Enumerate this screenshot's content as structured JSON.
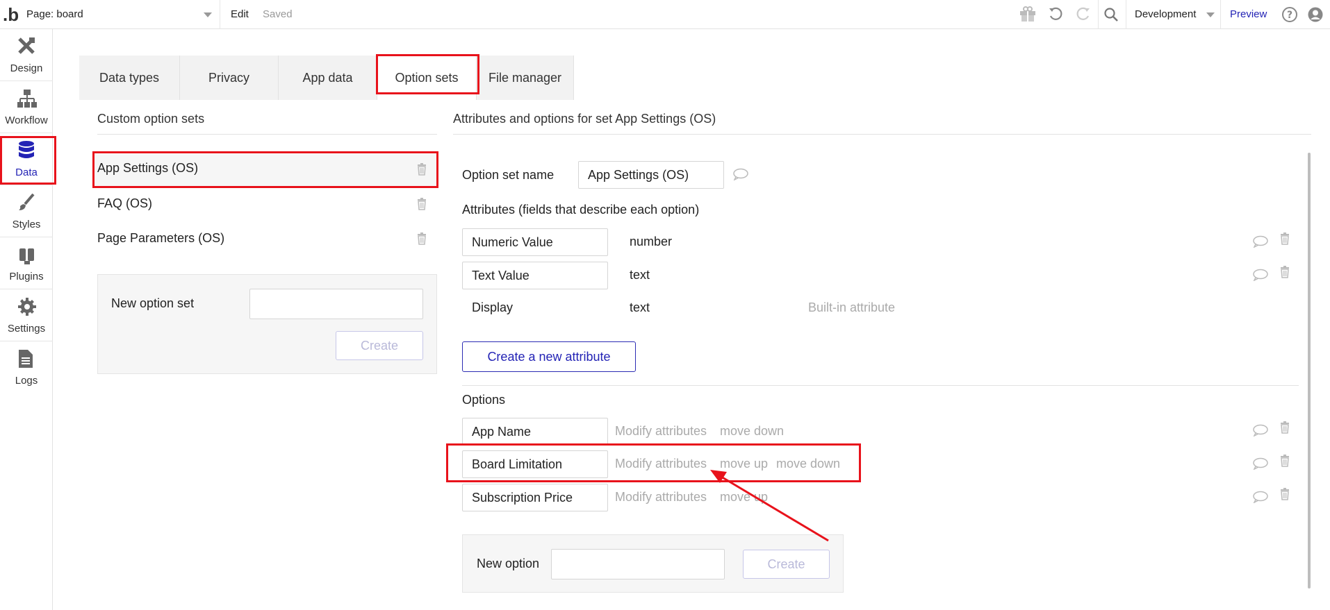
{
  "topbar": {
    "logo": ".b",
    "page_label": "Page: board",
    "edit": "Edit",
    "saved": "Saved",
    "environment": "Development",
    "preview": "Preview",
    "icons": [
      "gift-icon",
      "undo-icon",
      "redo-icon",
      "search-icon",
      "help-icon",
      "user-icon"
    ]
  },
  "sidebar": {
    "items": [
      {
        "label": "Design",
        "icon": "design-icon"
      },
      {
        "label": "Workflow",
        "icon": "workflow-icon"
      },
      {
        "label": "Data",
        "icon": "database-icon",
        "active": true
      },
      {
        "label": "Styles",
        "icon": "brush-icon"
      },
      {
        "label": "Plugins",
        "icon": "plug-icon"
      },
      {
        "label": "Settings",
        "icon": "gear-icon"
      },
      {
        "label": "Logs",
        "icon": "document-icon"
      }
    ]
  },
  "tabs": [
    "Data types",
    "Privacy",
    "App data",
    "Option sets",
    "File manager"
  ],
  "active_tab": "Option sets",
  "left": {
    "title": "Custom option sets",
    "sets": [
      "App Settings (OS)",
      "FAQ (OS)",
      "Page Parameters (OS)"
    ],
    "new_set_label": "New option set",
    "new_set_value": "",
    "create_label": "Create"
  },
  "right": {
    "title": "Attributes and options for set App Settings (OS)",
    "name_label": "Option set name",
    "name_value": "App Settings (OS)",
    "attributes_title": "Attributes (fields that describe each option)",
    "attributes": [
      {
        "name": "Numeric Value",
        "type": "number",
        "note": ""
      },
      {
        "name": "Text Value",
        "type": "text",
        "note": ""
      },
      {
        "name": "Display",
        "type": "text",
        "note": "Built-in attribute"
      }
    ],
    "create_attribute": "Create a new attribute",
    "options_title": "Options",
    "options": [
      {
        "name": "App Name",
        "actions": [
          "Modify attributes",
          "move down"
        ]
      },
      {
        "name": "Board Limitation",
        "actions": [
          "Modify attributes",
          "move up",
          "move down"
        ]
      },
      {
        "name": "Subscription Price",
        "actions": [
          "Modify attributes",
          "move up"
        ]
      }
    ],
    "new_option_label": "New option",
    "new_option_value": "",
    "create_label": "Create"
  },
  "colors": {
    "accent": "#2323b5",
    "highlight": "#e8121b",
    "muted": "#aaaaaa"
  }
}
